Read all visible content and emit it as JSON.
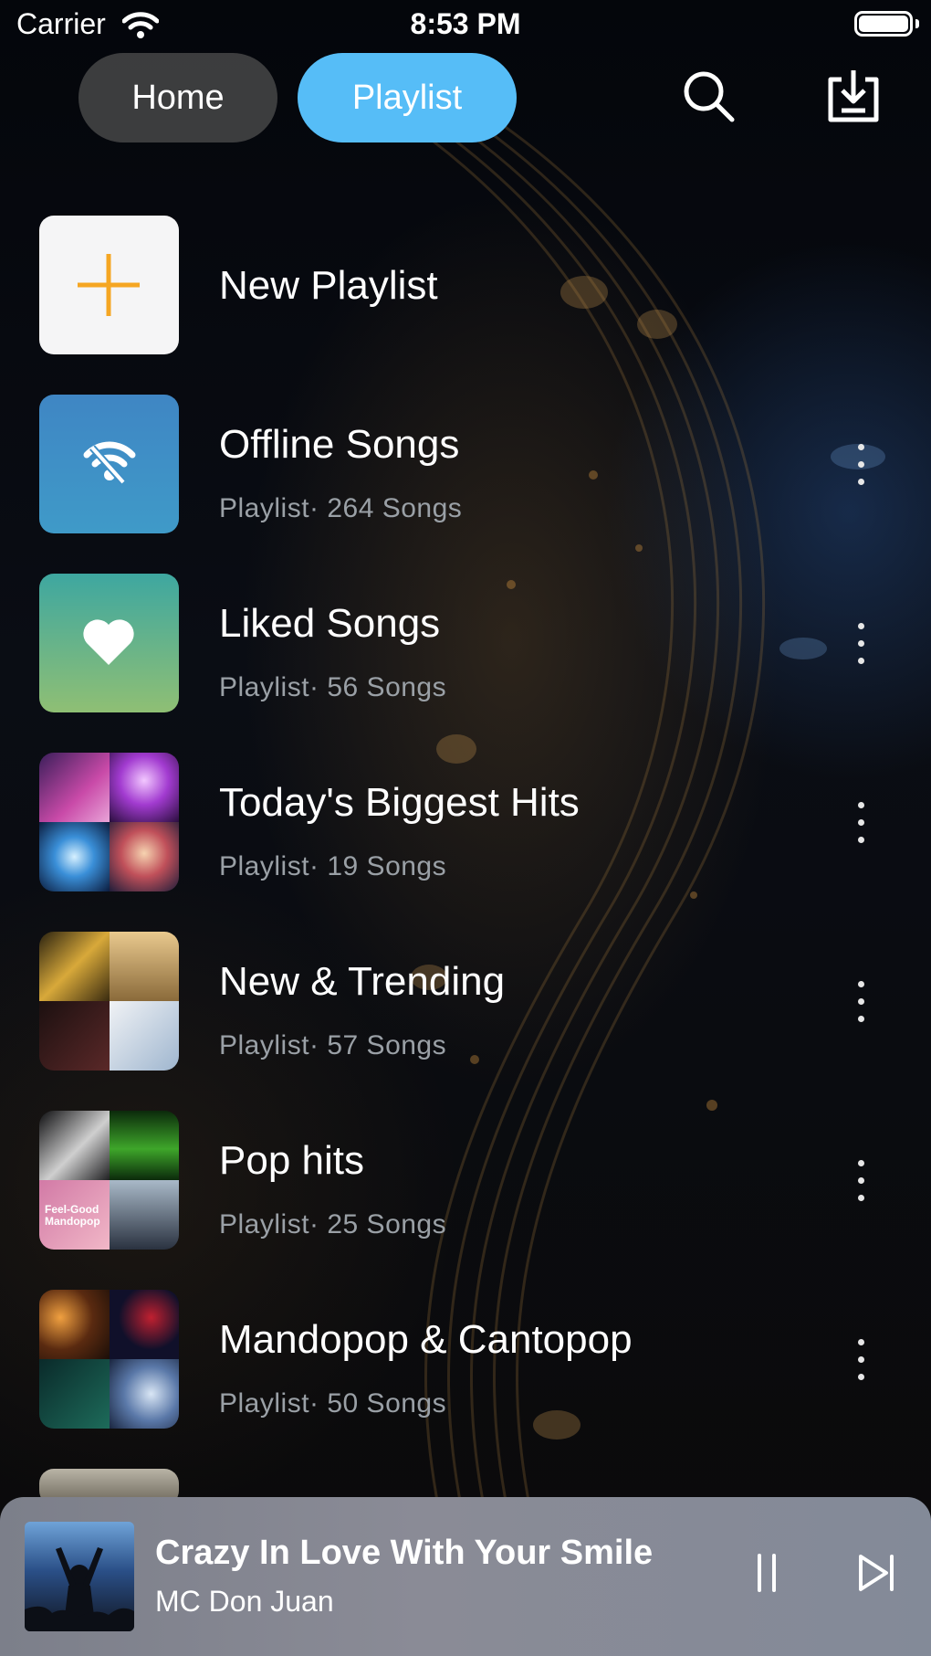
{
  "status_bar": {
    "carrier": "Carrier",
    "time": "8:53 PM"
  },
  "header": {
    "tabs": [
      {
        "label": "Home",
        "active": false
      },
      {
        "label": "Playlist",
        "active": true
      }
    ],
    "search_icon": "search-icon",
    "download_icon": "download-icon"
  },
  "colors": {
    "accent": "#56bdf7",
    "plus": "#f5a623",
    "background": "#05070c"
  },
  "new_playlist": {
    "label": "New Playlist"
  },
  "playlists": [
    {
      "title": "Offline Songs",
      "subtitle": "Playlist· 264 Songs",
      "icon": "offline-wifi-icon"
    },
    {
      "title": "Liked Songs",
      "subtitle": "Playlist· 56 Songs",
      "icon": "heart-icon"
    },
    {
      "title": "Today's Biggest Hits",
      "subtitle": "Playlist· 19 Songs"
    },
    {
      "title": "New & Trending",
      "subtitle": "Playlist· 57 Songs"
    },
    {
      "title": "Pop hits",
      "subtitle": "Playlist· 25 Songs",
      "cover_text": "Feel-Good Mandopop"
    },
    {
      "title": "Mandopop & Cantopop",
      "subtitle": "Playlist· 50 Songs"
    }
  ],
  "now_playing": {
    "title": "Crazy In Love With Your Smile",
    "artist": "MC Don Juan",
    "pause_icon": "pause-icon",
    "next_icon": "next-track-icon"
  }
}
